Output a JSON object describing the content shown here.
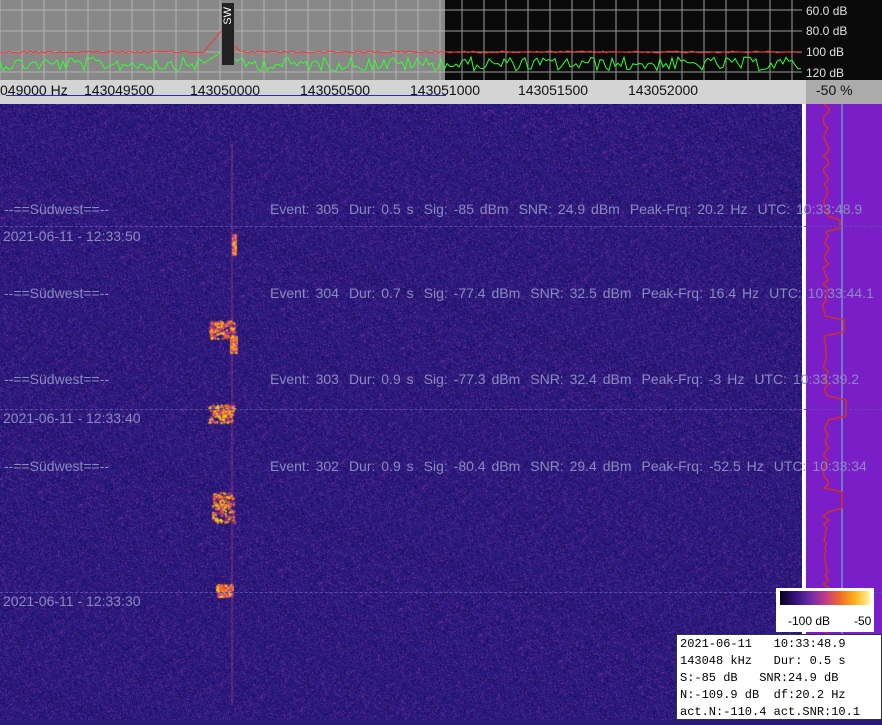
{
  "spectrum": {
    "db_labels": [
      "60.0 dB",
      "80.0 dB",
      "100 dB",
      "120 dB"
    ],
    "marker_label": "SW"
  },
  "scale": {
    "freq_labels": [
      "049000 Hz",
      "143049500",
      "143050000",
      "143050500",
      "143051000",
      "143051500",
      "143052000"
    ],
    "percent": "-50 %"
  },
  "waterfall": {
    "timestamps": [
      "2021-06-11 - 12:33:50",
      "2021-06-11 - 12:33:40",
      "2021-06-11 - 12:33:30"
    ],
    "events": [
      {
        "station": "--==Südwest==--",
        "event": "Event: 305",
        "dur": "Dur: 0.5 s",
        "sig": "Sig: -85 dBm",
        "snr": "SNR: 24.9 dBm",
        "peak": "Peak-Frq: 20.2 Hz",
        "utc": "UTC: 10:33:48.9"
      },
      {
        "station": "--==Südwest==--",
        "event": "Event: 304",
        "dur": "Dur: 0.7 s",
        "sig": "Sig: -77.4 dBm",
        "snr": "SNR: 32.5 dBm",
        "peak": "Peak-Frq: 16.4 Hz",
        "utc": "UTC: 10:33:44.1"
      },
      {
        "station": "--==Südwest==--",
        "event": "Event: 303",
        "dur": "Dur: 0.9 s",
        "sig": "Sig: -77.3 dBm",
        "snr": "SNR: 32.4 dBm",
        "peak": "Peak-Frq: -3 Hz",
        "utc": "UTC: 10:33:39.2"
      },
      {
        "station": "--==Südwest==--",
        "event": "Event: 302",
        "dur": "Dur: 0.9 s",
        "sig": "Sig: -80.4 dBm",
        "snr": "SNR: 29.4 dBm",
        "peak": "Peak-Frq: -52.5 Hz",
        "utc": "UTC: 10:33:34"
      }
    ]
  },
  "legend": {
    "min": "-100 dB",
    "max": "-50"
  },
  "info": {
    "line1": "2021-06-11   10:33:48.9",
    "line2": "143048 kHz   Dur: 0.5 s",
    "line3": "S:-85 dB   SNR:24.9 dB",
    "line4": "N:-109.9 dB  df:20.2 Hz",
    "line5": "act.N:-110.4 act.SNR:10.1"
  },
  "colors": {
    "background": "#2a1a78",
    "side_panel": "#7a1fc8",
    "spectrum_green": "#33ff33",
    "spectrum_red": "#ff3030"
  }
}
